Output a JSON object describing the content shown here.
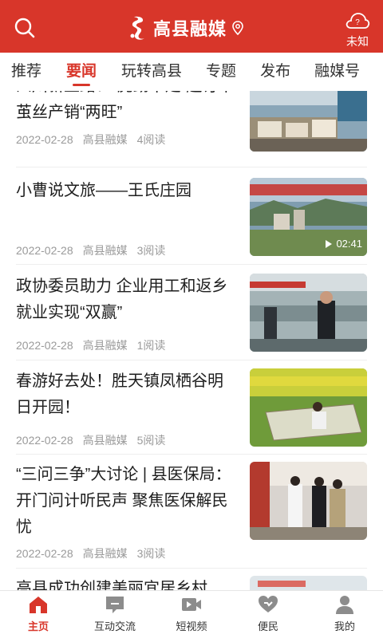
{
  "colors": {
    "brand": "#d8362a",
    "meta": "#9a9a9a",
    "icon_gray": "#8c8c8c"
  },
  "header": {
    "title": "高县融媒",
    "weather_label": "未知",
    "weather_icon_text": "?"
  },
  "tabs": [
    {
      "label": "推荐",
      "active": false
    },
    {
      "label": "要闻",
      "active": true
    },
    {
      "label": "玩转高县",
      "active": false
    },
    {
      "label": "专题",
      "active": false
    },
    {
      "label": "发布",
      "active": false
    },
    {
      "label": "融媒号",
      "active": false
    }
  ],
  "feed": [
    {
      "title": "四川新丝路：“虎劲十足”赶订单 茧丝产销“两旺”",
      "date": "2022-02-28",
      "source": "高县融媒",
      "reads": "4阅读"
    },
    {
      "title": "小曹说文旅——王氏庄园",
      "date": "2022-02-28",
      "source": "高县融媒",
      "reads": "3阅读",
      "video_duration": "02:41"
    },
    {
      "title": "政协委员助力 企业用工和返乡就业实现“双赢”",
      "date": "2022-02-28",
      "source": "高县融媒",
      "reads": "1阅读"
    },
    {
      "title": "春游好去处！胜天镇凤栖谷明日开园！",
      "date": "2022-02-28",
      "source": "高县融媒",
      "reads": "5阅读"
    },
    {
      "title": "“三问三争”大讨论 | 县医保局：开门问计听民声 聚焦医保解民忧",
      "date": "2022-02-28",
      "source": "高县融媒",
      "reads": "3阅读"
    },
    {
      "title": "高县成功创建美丽宜居乡村",
      "date": "",
      "source": "",
      "reads": ""
    }
  ],
  "bottom_nav": [
    {
      "label": "主页",
      "icon": "home-icon",
      "active": true
    },
    {
      "label": "互动交流",
      "icon": "chat-icon",
      "active": false
    },
    {
      "label": "短视频",
      "icon": "video-icon",
      "active": false
    },
    {
      "label": "便民",
      "icon": "heart-hand-icon",
      "active": false
    },
    {
      "label": "我的",
      "icon": "user-icon",
      "active": false
    }
  ]
}
